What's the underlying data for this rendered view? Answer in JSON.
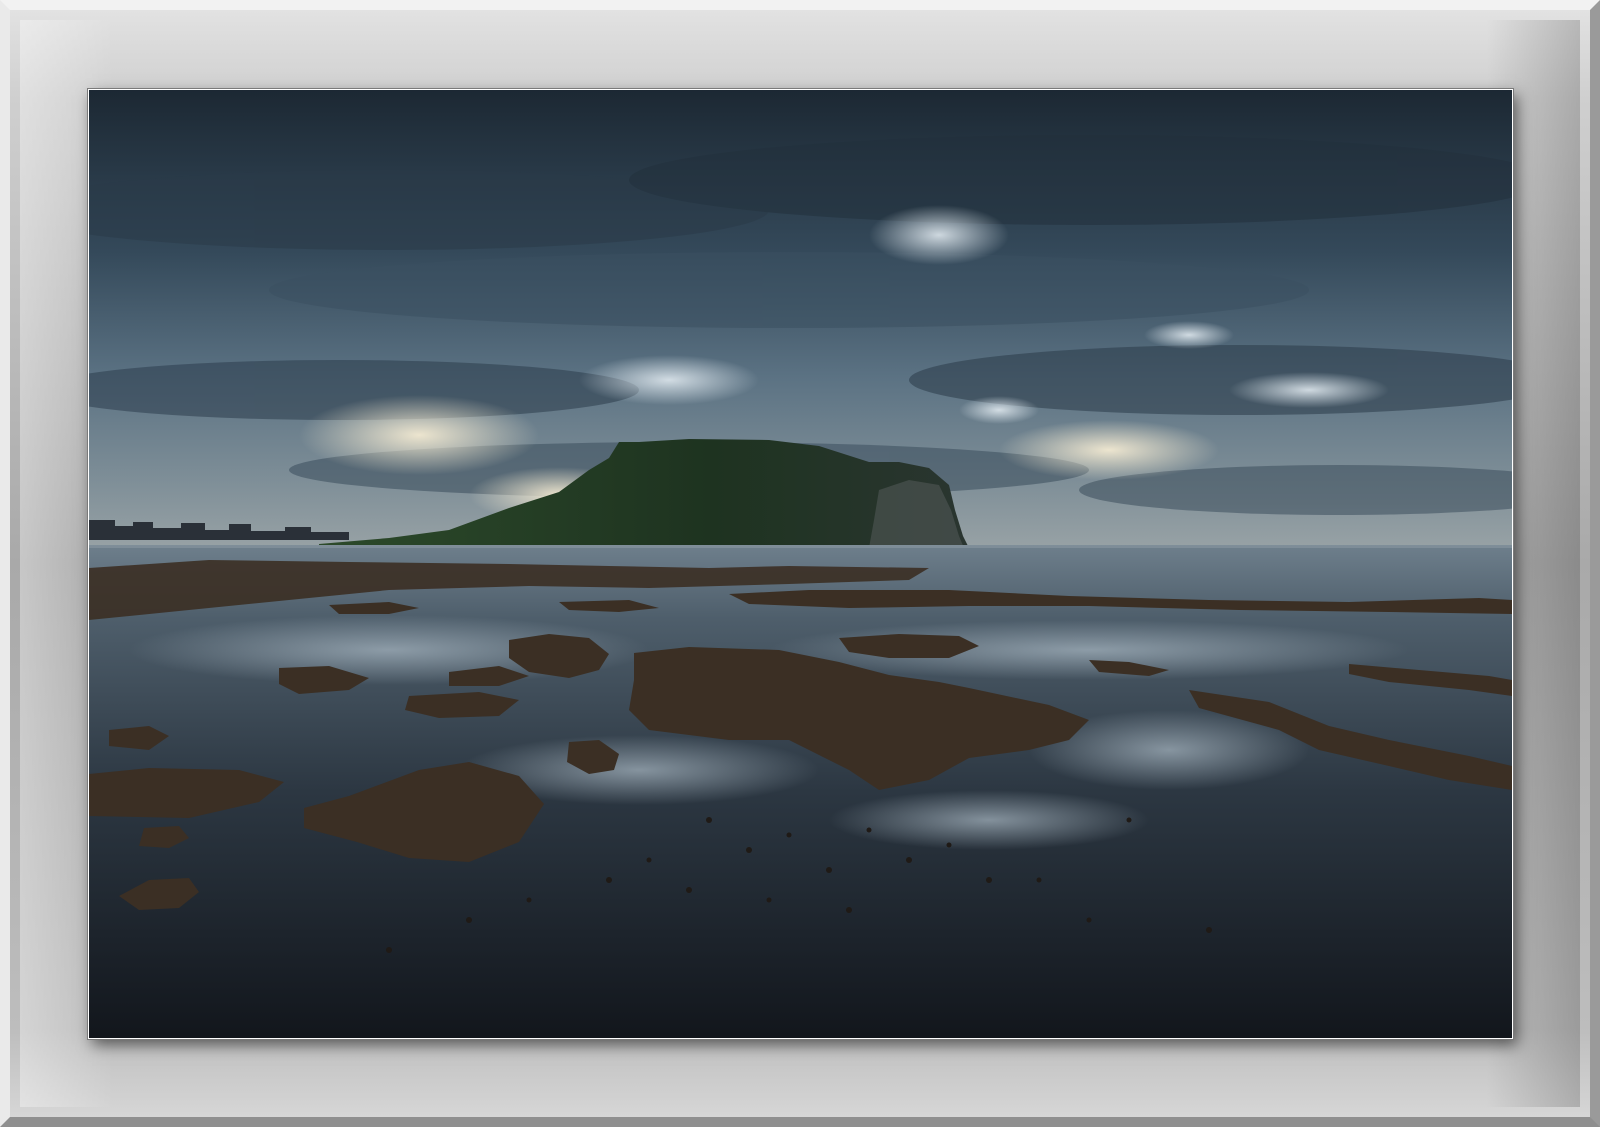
{
  "image": {
    "subject": "coastal-landscape",
    "palette": {
      "sky_dark": "#1e2a36",
      "sky_mid": "#4a6273",
      "sky_light": "#c9d4da",
      "horizon_glow": "#e8e2cf",
      "headland": "#1c2a20",
      "sea": "#4d5c69",
      "rock": "#3a2e22",
      "pool_reflection": "#6f8596",
      "frame_gray": "#a9a9a9"
    }
  }
}
